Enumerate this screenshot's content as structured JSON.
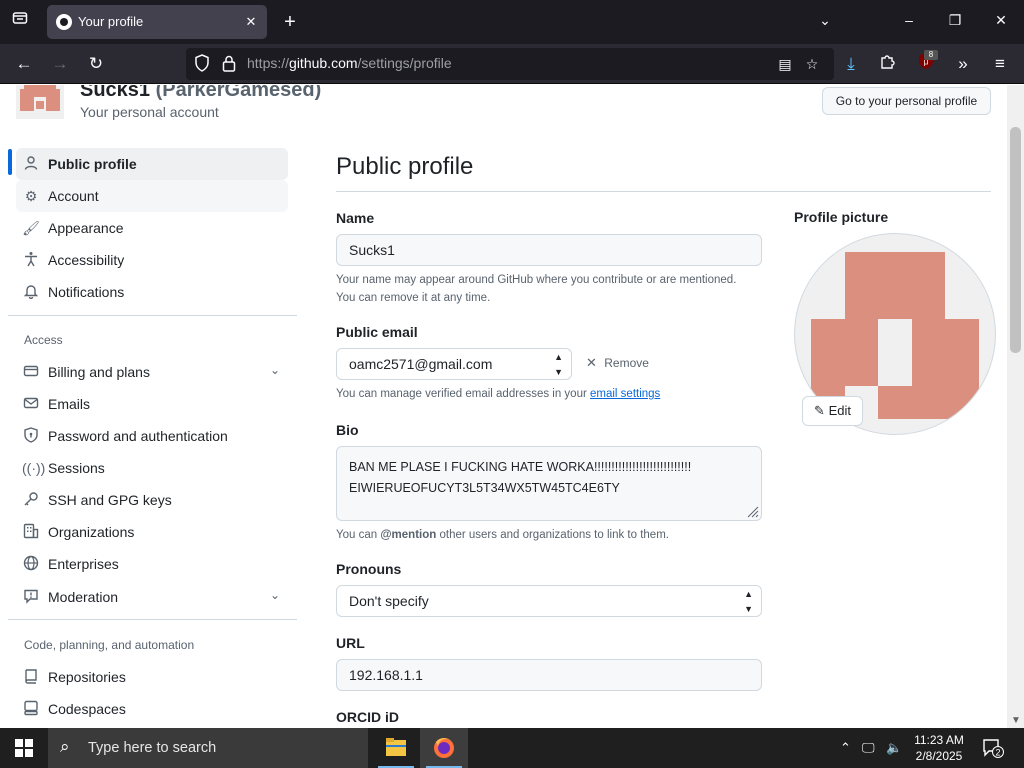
{
  "browser": {
    "tab_title": "Your profile",
    "url_scheme": "https://",
    "url_host": "github.com",
    "url_path": "/settings/profile",
    "extension_badge": "8"
  },
  "account": {
    "name": "Sucks1",
    "handle": "(ParkerGamesed)",
    "subtitle": "Your personal account",
    "personal_profile_button": "Go to your personal profile"
  },
  "sidebar": {
    "items": [
      {
        "label": "Public profile",
        "icon": "person-icon"
      },
      {
        "label": "Account",
        "icon": "gear-icon"
      },
      {
        "label": "Appearance",
        "icon": "paintbrush-icon"
      },
      {
        "label": "Accessibility",
        "icon": "accessibility-icon"
      },
      {
        "label": "Notifications",
        "icon": "bell-icon"
      }
    ],
    "access_heading": "Access",
    "access_items": [
      {
        "label": "Billing and plans",
        "icon": "credit-card-icon"
      },
      {
        "label": "Emails",
        "icon": "mail-icon"
      },
      {
        "label": "Password and authentication",
        "icon": "shield-lock-icon"
      },
      {
        "label": "Sessions",
        "icon": "broadcast-icon"
      },
      {
        "label": "SSH and GPG keys",
        "icon": "key-icon"
      },
      {
        "label": "Organizations",
        "icon": "organization-icon"
      },
      {
        "label": "Enterprises",
        "icon": "globe-icon"
      },
      {
        "label": "Moderation",
        "icon": "report-icon"
      }
    ],
    "code_heading": "Code, planning, and automation",
    "code_items": [
      {
        "label": "Repositories",
        "icon": "repo-icon"
      },
      {
        "label": "Codespaces",
        "icon": "codespaces-icon"
      }
    ]
  },
  "main": {
    "title": "Public profile",
    "name_label": "Name",
    "name_value": "Sucks1",
    "name_note_1": "Your name may appear around GitHub where you contribute or are mentioned.",
    "name_note_2": "You can remove it at any time.",
    "email_label": "Public email",
    "email_value": "oamc2571@gmail.com",
    "remove_label": "Remove",
    "email_note_prefix": "You can manage verified email addresses in your ",
    "email_note_link": "email settings",
    "bio_label": "Bio",
    "bio_line_1": "BAN ME PLASE I FUCKING HATE WORKA!!!!!!!!!!!!!!!!!!!!!!!!!!!!",
    "bio_line_2": "EIWIERUEOFUCYT3L5T34WX5TW45TC4E6TY",
    "bio_note_prefix": "You can ",
    "bio_note_mention": "@mention",
    "bio_note_suffix": " other users and organizations to link to them.",
    "pronouns_label": "Pronouns",
    "pronouns_value": "Don't specify",
    "url_label": "URL",
    "url_value": "192.168.1.1",
    "orcid_label": "ORCID iD",
    "profile_picture_label": "Profile picture",
    "edit_label": "Edit"
  },
  "taskbar": {
    "search_placeholder": "Type here to search",
    "time": "11:23 AM",
    "date": "2/8/2025",
    "notification_count": "2"
  },
  "colors": {
    "identicon": "#da8f7f",
    "accent": "#0969da"
  }
}
